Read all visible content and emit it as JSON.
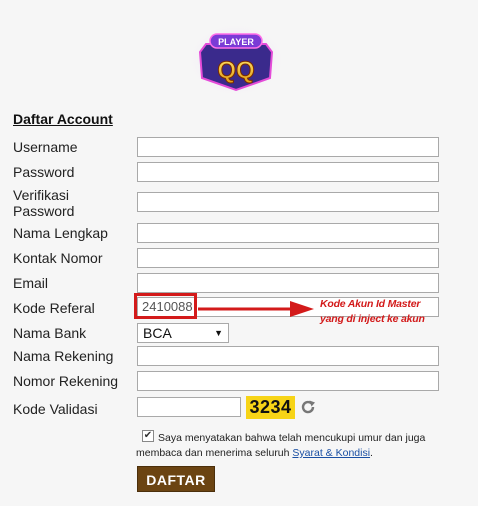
{
  "logo": {
    "top_text": "PLAYER",
    "main_text": "QQ"
  },
  "form": {
    "title": "Daftar Account",
    "fields": [
      {
        "label": "Username",
        "value": ""
      },
      {
        "label": "Password",
        "value": ""
      },
      {
        "label_line1": "Verifikasi",
        "label_line2": "Password",
        "value": ""
      },
      {
        "label": "Nama Lengkap",
        "value": ""
      },
      {
        "label": "Kontak Nomor",
        "value": ""
      },
      {
        "label": "Email",
        "value": ""
      },
      {
        "label": "Kode Referal",
        "value": "2410088"
      },
      {
        "label": "Nama Bank",
        "value": "BCA"
      },
      {
        "label": "Nama Rekening",
        "value": ""
      },
      {
        "label": "Nomor Rekening",
        "value": ""
      },
      {
        "label": "Kode Validasi",
        "value": ""
      }
    ],
    "captcha": "3234",
    "agree_text_1": "Saya menyatakan bahwa telah mencukupi umur dan juga",
    "agree_text_2": "membaca dan menerima seluruh",
    "terms_link": "Syarat & Kondisi",
    "agree_end": ".",
    "checked": true,
    "submit_label": "DAFTAR"
  },
  "annotation": {
    "line1": "Kode Akun Id Master",
    "line2": "yang di inject ke akun",
    "color": "#d31a1a"
  },
  "colors": {
    "captcha_bg": "#f7d417",
    "submit_bg": "#6b4412",
    "link": "#1a4fa3"
  }
}
